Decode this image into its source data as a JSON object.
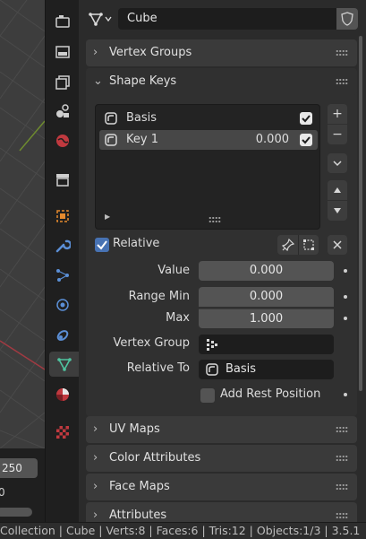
{
  "viewport": {
    "frame_field": "250",
    "second_field": "0"
  },
  "header": {
    "object_name": "Cube"
  },
  "panels": {
    "vertex_groups": "Vertex Groups",
    "shape_keys": "Shape Keys",
    "uv_maps": "UV Maps",
    "color_attributes": "Color Attributes",
    "face_maps": "Face Maps",
    "attributes": "Attributes"
  },
  "shape_keys": {
    "list": [
      {
        "name": "Basis",
        "value": "",
        "checked": true
      },
      {
        "name": "Key 1",
        "value": "0.000",
        "checked": true
      }
    ],
    "relative_label": "Relative",
    "value_label": "Value",
    "value": "0.000",
    "range_min_label": "Range Min",
    "range_min": "0.000",
    "max_label": "Max",
    "max": "1.000",
    "vertex_group_label": "Vertex Group",
    "vertex_group": "",
    "relative_to_label": "Relative To",
    "relative_to": "Basis",
    "add_rest_position_label": "Add Rest Position"
  },
  "side_buttons": {
    "add": "+",
    "remove": "−"
  },
  "status_bar": {
    "text": "Collection | Cube | Verts:8 | Faces:6 | Tris:12 | Objects:1/3 | 3.5.1"
  },
  "colors": {
    "accent_blue": "#4772b3",
    "active_tab_green": "#4fc4a0",
    "field": "#545454",
    "panel": "#303030"
  },
  "tab_icons": [
    "render-icon",
    "output-icon",
    "view-layer-icon",
    "scene-icon",
    "world-icon",
    "collection-icon",
    "object-icon",
    "modifier-icon",
    "particles-icon",
    "physics-icon",
    "constraints-icon",
    "data-icon",
    "material-icon",
    "texture-icon"
  ]
}
